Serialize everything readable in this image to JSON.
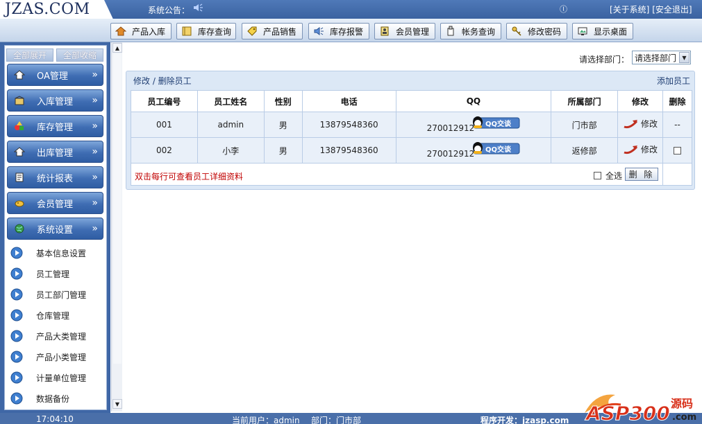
{
  "app": {
    "logo": "JZAS.COM"
  },
  "header": {
    "notice_label": "系统公告：",
    "about": "[关于系统]",
    "logout": "[安全退出]"
  },
  "toolbar": {
    "buttons": [
      {
        "label": "产品入库",
        "icon": "house-arrow-icon"
      },
      {
        "label": "库存查询",
        "icon": "book-icon"
      },
      {
        "label": "产品销售",
        "icon": "tag-icon"
      },
      {
        "label": "库存报警",
        "icon": "speaker-icon"
      },
      {
        "label": "会员管理",
        "icon": "id-card-icon"
      },
      {
        "label": "帐务查询",
        "icon": "ledger-icon"
      },
      {
        "label": "修改密码",
        "icon": "keys-icon"
      },
      {
        "label": "显示桌面",
        "icon": "desktop-icon"
      }
    ]
  },
  "sidebar": {
    "expand_all": "全部展开",
    "collapse_all": "全部收缩",
    "menus": [
      {
        "label": "OA管理"
      },
      {
        "label": "入库管理"
      },
      {
        "label": "库存管理"
      },
      {
        "label": "出库管理"
      },
      {
        "label": "统计报表"
      },
      {
        "label": "会员管理"
      },
      {
        "label": "系统设置"
      }
    ],
    "chevron": "»",
    "sub_items": [
      {
        "label": "基本信息设置"
      },
      {
        "label": "员工管理"
      },
      {
        "label": "员工部门管理"
      },
      {
        "label": "仓库管理"
      },
      {
        "label": "产品大类管理"
      },
      {
        "label": "产品小类管理"
      },
      {
        "label": "计量单位管理"
      },
      {
        "label": "数据备份"
      }
    ]
  },
  "filter": {
    "label": "请选择部门：",
    "selected": "请选择部门"
  },
  "panel": {
    "title": "修改 / 删除员工",
    "add_link": "添加员工",
    "columns": [
      "员工编号",
      "员工姓名",
      "性别",
      "电话",
      "QQ",
      "所属部门",
      "修改",
      "删除"
    ],
    "rows": [
      {
        "id": "001",
        "name": "admin",
        "gender": "男",
        "phone": "13879548360",
        "qq": "270012912",
        "qq_badge": "QQ交谈",
        "dept": "门市部",
        "edit": "修改",
        "delete": "--"
      },
      {
        "id": "002",
        "name": "小李",
        "gender": "男",
        "phone": "13879548360",
        "qq": "270012912",
        "qq_badge": "QQ交谈",
        "dept": "返修部",
        "edit": "修改",
        "delete": ""
      }
    ],
    "footer_note": "双击每行可查看员工详细资料",
    "select_all": "全选",
    "delete_button": "删 除"
  },
  "status": {
    "time": "17:04:10",
    "user": "当前用户：admin",
    "dept": "部门：门市部",
    "dev": "程序开发：jzasp.com"
  },
  "watermark": {
    "text": "ASP300",
    "sub": "源码",
    "domain": ".com"
  },
  "colors": {
    "header": "#3a62a0",
    "menu": "#3f6db3",
    "panel": "#dce8f6",
    "note": "#c00000"
  }
}
